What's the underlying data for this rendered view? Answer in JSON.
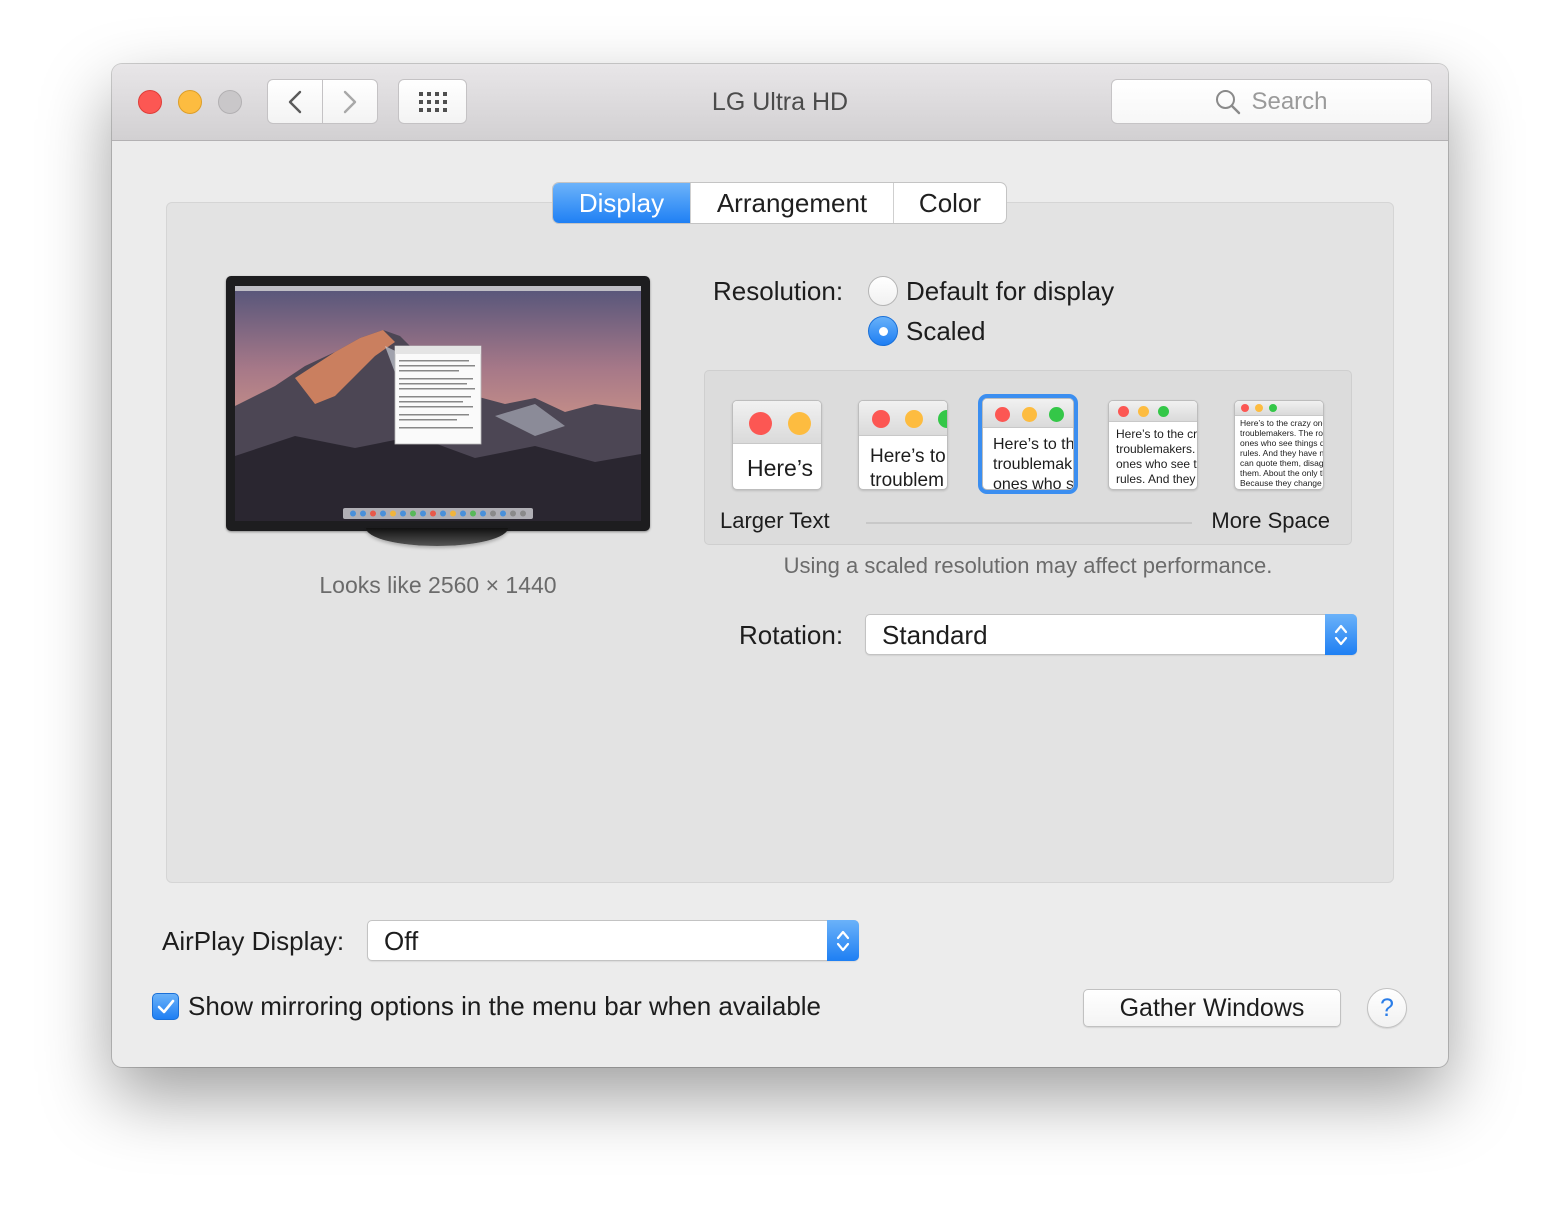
{
  "window": {
    "title": "LG Ultra HD"
  },
  "toolbar": {
    "search_placeholder": "Search",
    "back_icon": "chevron-left-icon",
    "forward_icon": "chevron-right-icon",
    "show_all_icon": "grid-icon"
  },
  "tabs": [
    {
      "label": "Display",
      "active": true
    },
    {
      "label": "Arrangement",
      "active": false
    },
    {
      "label": "Color",
      "active": false
    }
  ],
  "display": {
    "looks_like": "Looks like 2560 × 1440",
    "resolution_label": "Resolution:",
    "resolution_options": [
      {
        "label": "Default for display",
        "selected": false
      },
      {
        "label": "Scaled",
        "selected": true
      }
    ],
    "scaled_previews": [
      {
        "text": "Here’s",
        "selected": false
      },
      {
        "text": "Here’s to\ntroublem",
        "selected": false
      },
      {
        "text": "Here’s to th\ntroublemak\nones who s",
        "selected": true
      },
      {
        "text": "Here’s to the cr\ntroublemakers.\nones who see t\nrules. And they",
        "selected": false
      },
      {
        "text": "Here’s to the crazy one\ntroublemakers. The rou\nones who see things dif\nrules. And they have no\ncan quote them, disagr\nthem. About the only th\nBecause they change t",
        "selected": false
      }
    ],
    "scale_left_label": "Larger Text",
    "scale_right_label": "More Space",
    "performance_note": "Using a scaled resolution may affect performance.",
    "rotation_label": "Rotation:",
    "rotation_value": "Standard"
  },
  "footer": {
    "airplay_label": "AirPlay Display:",
    "airplay_value": "Off",
    "mirroring_checkbox_label": "Show mirroring options in the menu bar when available",
    "mirroring_checked": true,
    "gather_button": "Gather Windows",
    "help_button": "?"
  },
  "colors": {
    "accent": "#1f80f4",
    "close": "#fc5753",
    "minimize": "#fdbc40",
    "zoom_disabled": "#c9c7c9"
  }
}
